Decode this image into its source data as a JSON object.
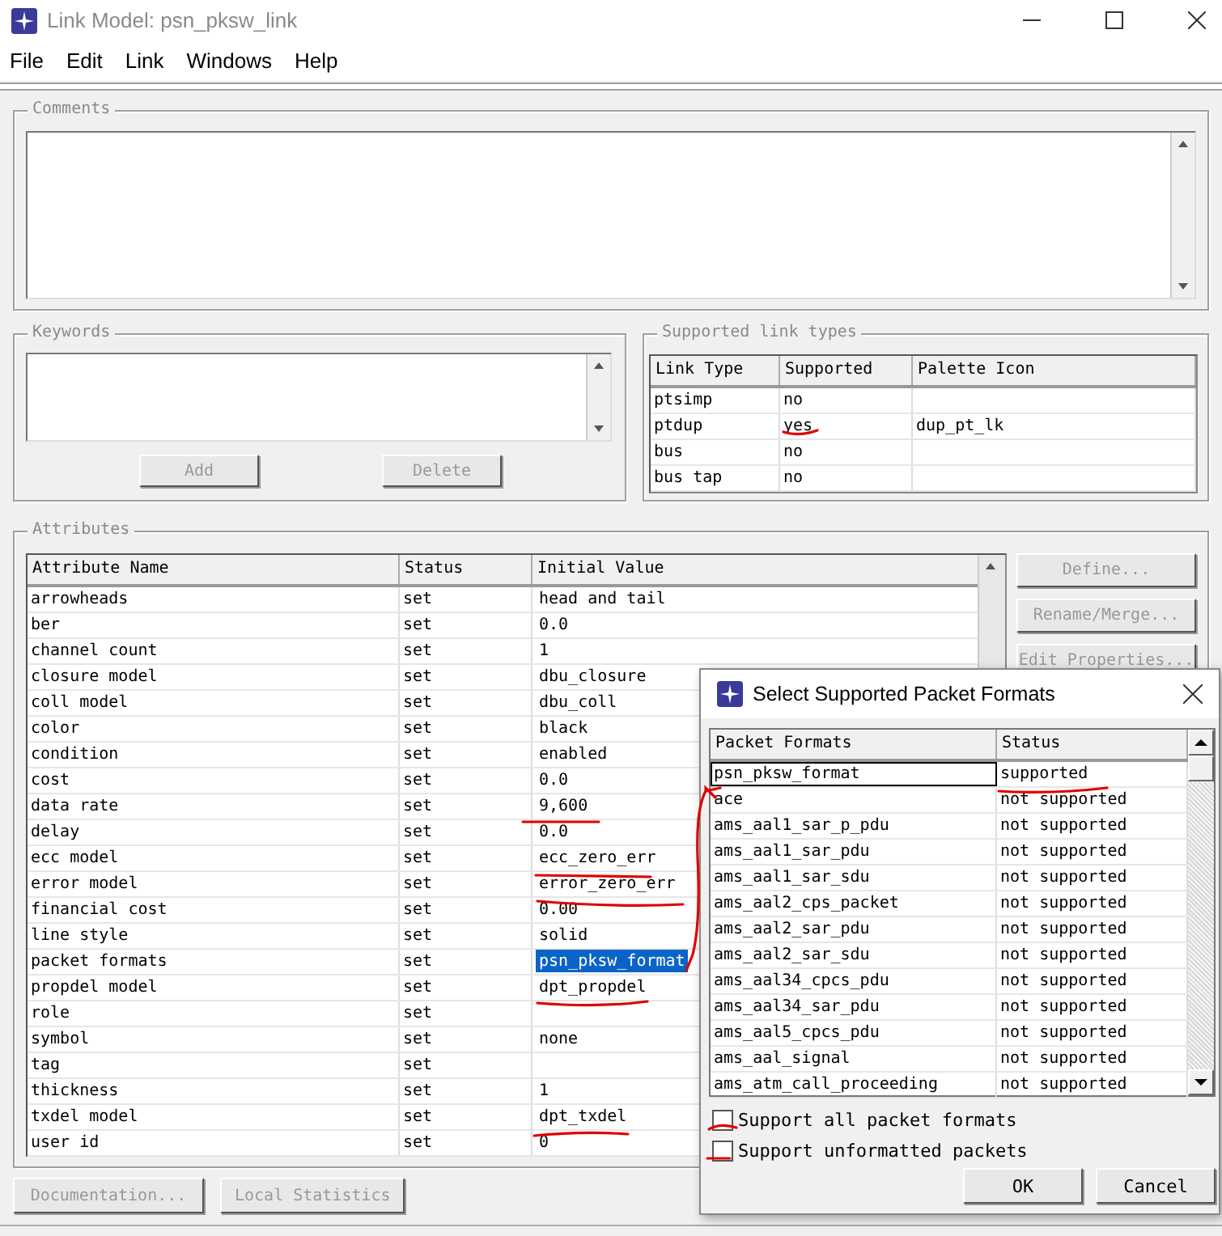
{
  "window": {
    "title": "Link Model: psn_pksw_link"
  },
  "menu": [
    "File",
    "Edit",
    "Link",
    "Windows",
    "Help"
  ],
  "comments": {
    "label": "Comments"
  },
  "keywords": {
    "label": "Keywords",
    "buttons": [
      {
        "label": "Add",
        "disabled": true
      },
      {
        "label": "Delete",
        "disabled": true
      }
    ]
  },
  "link_types": {
    "label": "Supported link types",
    "columns": [
      "Link Type",
      "Supported",
      "Palette Icon"
    ],
    "rows": [
      {
        "type": "ptsimp",
        "supported": "no"
      },
      {
        "type": "ptdup",
        "supported": "yes",
        "palette_icon": "dup_pt_lk"
      },
      {
        "type": "bus",
        "supported": "no"
      },
      {
        "type": "bus tap",
        "supported": "no"
      }
    ]
  },
  "attributes": {
    "label": "Attributes",
    "columns": [
      "Attribute Name",
      "Status",
      "Initial Value"
    ],
    "rows": [
      {
        "name": "arrowheads",
        "status": "set",
        "value": "head and tail",
        "selected": false
      },
      {
        "name": "ber",
        "status": "set",
        "value": "0.0",
        "selected": false
      },
      {
        "name": "channel count",
        "status": "set",
        "value": "1",
        "selected": false
      },
      {
        "name": "closure model",
        "status": "set",
        "value": "dbu_closure",
        "selected": false
      },
      {
        "name": "coll model",
        "status": "set",
        "value": "dbu_coll",
        "selected": false
      },
      {
        "name": "color",
        "status": "set",
        "value": "black",
        "selected": false
      },
      {
        "name": "condition",
        "status": "set",
        "value": "enabled",
        "selected": false
      },
      {
        "name": "cost",
        "status": "set",
        "value": "0.0",
        "selected": false
      },
      {
        "name": "data rate",
        "status": "set",
        "value": "9,600",
        "selected": false
      },
      {
        "name": "delay",
        "status": "set",
        "value": "0.0",
        "selected": false
      },
      {
        "name": "ecc model",
        "status": "set",
        "value": "ecc_zero_err",
        "selected": false
      },
      {
        "name": "error model",
        "status": "set",
        "value": "error_zero_err",
        "selected": false
      },
      {
        "name": "financial cost",
        "status": "set",
        "value": "0.00",
        "selected": false
      },
      {
        "name": "line style",
        "status": "set",
        "value": "solid",
        "selected": false
      },
      {
        "name": "packet formats",
        "status": "set",
        "value": "psn_pksw_format",
        "selected": true
      },
      {
        "name": "propdel model",
        "status": "set",
        "value": "dpt_propdel",
        "selected": false
      },
      {
        "name": "role",
        "status": "set",
        "selected": false
      },
      {
        "name": "symbol",
        "status": "set",
        "value": "none",
        "selected": false
      },
      {
        "name": "tag",
        "status": "set",
        "selected": false
      },
      {
        "name": "thickness",
        "status": "set",
        "value": "1",
        "selected": false
      },
      {
        "name": "txdel model",
        "status": "set",
        "value": "dpt_txdel",
        "selected": false
      },
      {
        "name": "user id",
        "status": "set",
        "value": "0",
        "selected": false
      }
    ]
  },
  "side_buttons": [
    {
      "label": "Define...",
      "disabled": true
    },
    {
      "label": "Rename/Merge...",
      "disabled": true
    },
    {
      "label": "Edit Properties...",
      "disabled": true
    }
  ],
  "bottom_buttons": [
    {
      "label": "Documentation...",
      "disabled": true
    },
    {
      "label": "Local Statistics",
      "disabled": true
    }
  ],
  "dialog": {
    "title": "Select Supported Packet Formats",
    "columns": [
      "Packet Formats",
      "Status"
    ],
    "rows": [
      {
        "format": "psn_pksw_format",
        "status": "supported",
        "selected": true
      },
      {
        "format": "ace",
        "status": "not supported",
        "selected": false
      },
      {
        "format": "ams_aal1_sar_p_pdu",
        "status": "not supported",
        "selected": false
      },
      {
        "format": "ams_aal1_sar_pdu",
        "status": "not supported",
        "selected": false
      },
      {
        "format": "ams_aal1_sar_sdu",
        "status": "not supported",
        "selected": false
      },
      {
        "format": "ams_aal2_cps_packet",
        "status": "not supported",
        "selected": false
      },
      {
        "format": "ams_aal2_sar_pdu",
        "status": "not supported",
        "selected": false
      },
      {
        "format": "ams_aal2_sar_sdu",
        "status": "not supported",
        "selected": false
      },
      {
        "format": "ams_aal34_cpcs_pdu",
        "status": "not supported",
        "selected": false
      },
      {
        "format": "ams_aal34_sar_pdu",
        "status": "not supported",
        "selected": false
      },
      {
        "format": "ams_aal5_cpcs_pdu",
        "status": "not supported",
        "selected": false
      },
      {
        "format": "ams_aal_signal",
        "status": "not supported",
        "selected": false
      },
      {
        "format": "ams_atm_call_proceeding",
        "status": "not supported",
        "selected": false
      }
    ],
    "options": [
      {
        "label": "Support all packet formats",
        "checked": false
      },
      {
        "label": "Support unformatted packets",
        "checked": false
      }
    ],
    "buttons": [
      "OK",
      "Cancel"
    ]
  }
}
